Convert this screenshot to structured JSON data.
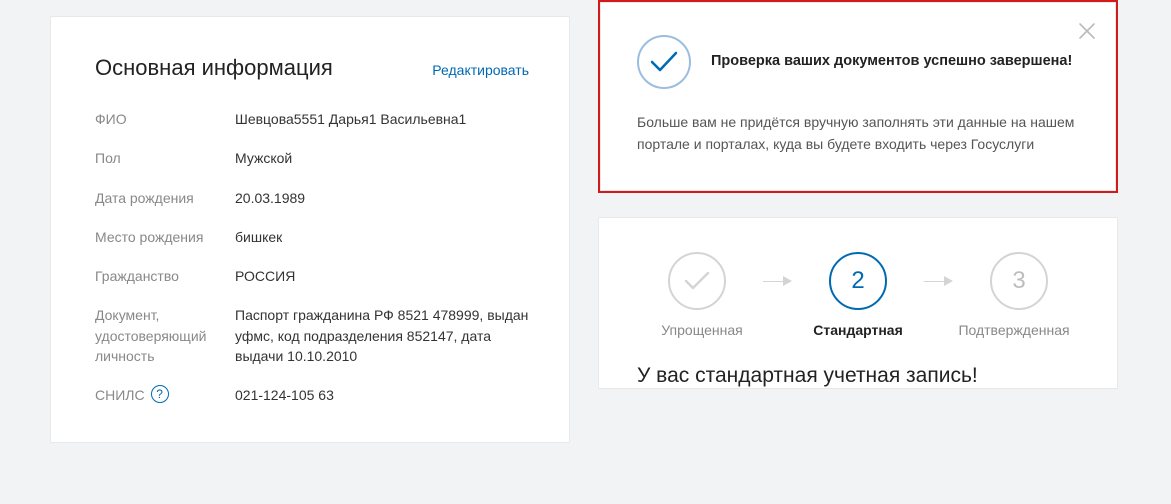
{
  "main": {
    "title": "Основная информация",
    "edit": "Редактировать",
    "fields": {
      "fio_label": "ФИО",
      "fio_value": "Шевцова5551 Дарья1 Васильевна1",
      "gender_label": "Пол",
      "gender_value": "Мужской",
      "dob_label": "Дата рождения",
      "dob_value": "20.03.1989",
      "pob_label": "Место рождения",
      "pob_value": "бишкек",
      "citizenship_label": "Гражданство",
      "citizenship_value": "РОССИЯ",
      "doc_label": "Документ, удостоверяющий личность",
      "doc_value": "Паспорт гражданина РФ 8521 478999, выдан уфмс, код подразделения 852147, дата выдачи 10.10.2010",
      "snils_label": "СНИЛС",
      "snils_value": "021-124-105 63"
    }
  },
  "notice": {
    "title": "Проверка ваших документов успешно завершена!",
    "body": "Больше вам не придётся вручную заполнять эти данные на нашем портале и порталах, куда вы будете входить через Госуслуги"
  },
  "steps": {
    "s1_label": "Упрощенная",
    "s2_num": "2",
    "s2_label": "Стандартная",
    "s3_num": "3",
    "s3_label": "Подтвержденная",
    "status": "У вас стандартная учетная запись!"
  },
  "help_glyph": "?"
}
